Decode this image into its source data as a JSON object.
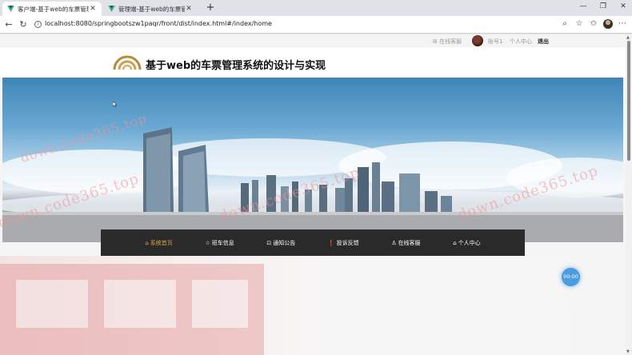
{
  "browser": {
    "tabs": [
      {
        "title": "客户端-基于web的车票管理系统的",
        "active": true
      },
      {
        "title": "管理端-基于web的车票管理系统的",
        "active": false
      }
    ],
    "close_glyph": "✕",
    "new_tab_glyph": "+",
    "url": "localhost:8080/springbootszw1paqr/front/dist/index.html#/index/home",
    "window_controls": {
      "minimize": "—",
      "restore": "❐",
      "close": "✕"
    },
    "nav": {
      "back": "←",
      "refresh": "↻"
    }
  },
  "topbar": {
    "customer_service": "⊞ 在线客服",
    "account": "账号1",
    "personal_center": "个人中心",
    "logout": "退出"
  },
  "header": {
    "title": "基于web的车票管理系统的设计与实现"
  },
  "menu": [
    {
      "icon": "⌂",
      "label": "系统首页",
      "active": true
    },
    {
      "icon": "☆",
      "label": "班车信息",
      "active": false
    },
    {
      "icon": "⊡",
      "label": "通知公告",
      "active": false
    },
    {
      "icon": "❗",
      "label": "投诉反馈",
      "active": false
    },
    {
      "icon": "♙",
      "label": "在线客服",
      "active": false
    },
    {
      "icon": "⌂",
      "label": "个人中心",
      "active": false
    }
  ],
  "timer": "00:00",
  "watermark": "down.code365.top",
  "colors": {
    "menu_bg": "#2a2a2a",
    "menu_active": "#d9a54c",
    "timer_bg": "#4a9be0"
  }
}
